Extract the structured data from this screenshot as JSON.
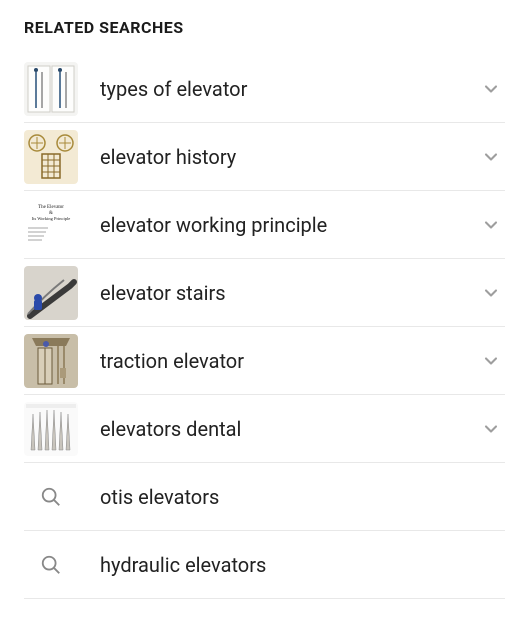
{
  "section_title": "RELATED SEARCHES",
  "items": [
    {
      "label": "types of elevator",
      "has_thumb": true,
      "has_chevron": true,
      "thumb_key": "types"
    },
    {
      "label": "elevator history",
      "has_thumb": true,
      "has_chevron": true,
      "thumb_key": "history"
    },
    {
      "label": "elevator working principle",
      "has_thumb": true,
      "has_chevron": true,
      "thumb_key": "principle"
    },
    {
      "label": "elevator stairs",
      "has_thumb": true,
      "has_chevron": true,
      "thumb_key": "stairs"
    },
    {
      "label": "traction elevator",
      "has_thumb": true,
      "has_chevron": true,
      "thumb_key": "traction"
    },
    {
      "label": "elevators dental",
      "has_thumb": true,
      "has_chevron": true,
      "thumb_key": "dental"
    },
    {
      "label": "otis elevators",
      "has_thumb": false,
      "has_chevron": false
    },
    {
      "label": "hydraulic elevators",
      "has_thumb": false,
      "has_chevron": false
    }
  ],
  "thumb_text": {
    "principle_line1": "The Elevator",
    "principle_line2": "&",
    "principle_line3": "Its Working Principle"
  }
}
